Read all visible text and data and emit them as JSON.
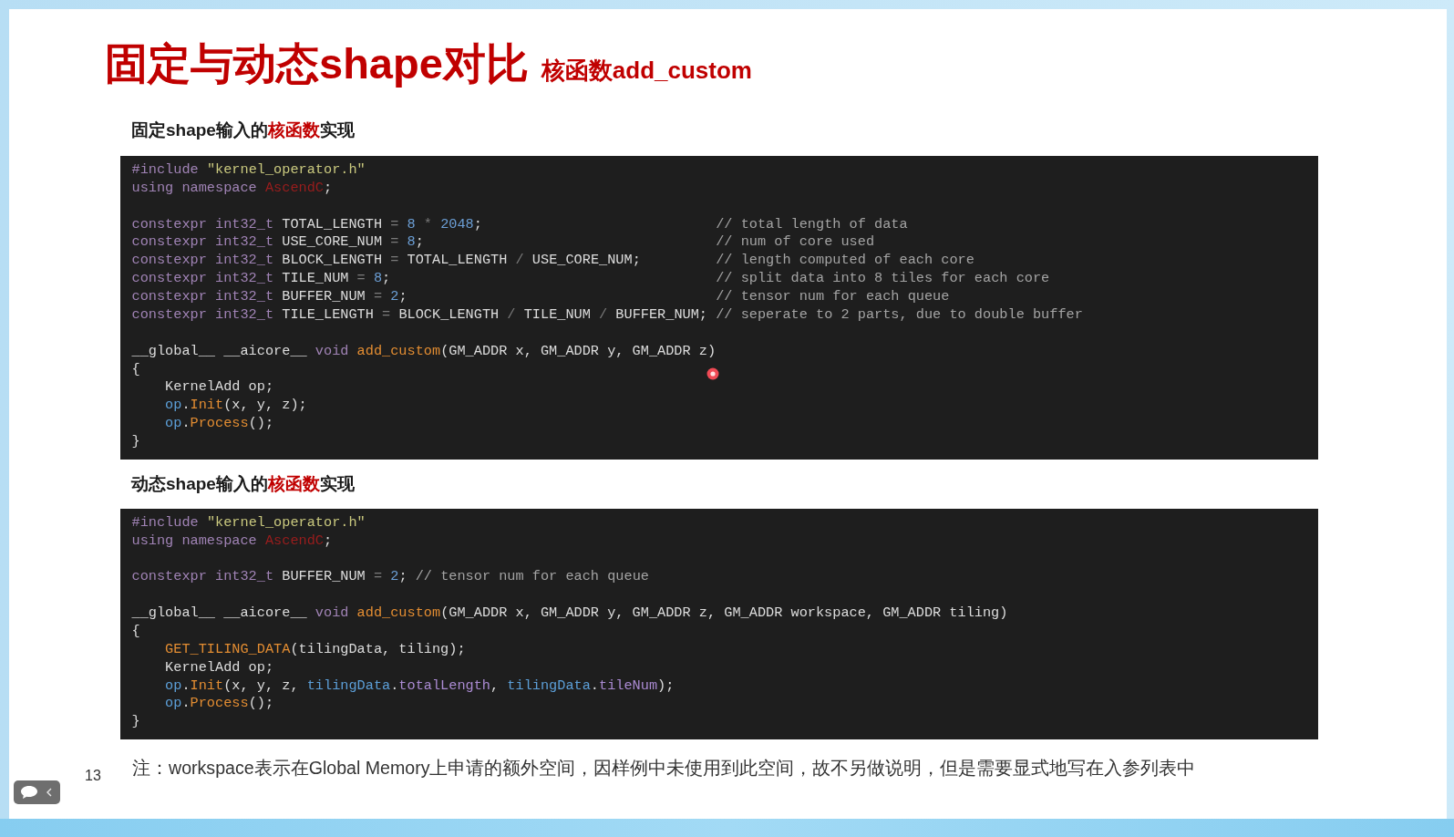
{
  "title": {
    "main": "固定与动态shape对比",
    "sub": "核函数add_custom"
  },
  "sections": [
    {
      "heading": [
        {
          "kind": "plain",
          "text": "固定shape输入的"
        },
        {
          "kind": "highlight",
          "text": "核函数"
        },
        {
          "kind": "plain",
          "text": "实现"
        }
      ],
      "code": {
        "groups": [
          [
            {
              "tokens": [
                {
                  "kind": "kw",
                  "text": "#include "
                },
                {
                  "kind": "str",
                  "text": "\"kernel_operator.h\""
                }
              ]
            },
            {
              "tokens": [
                {
                  "kind": "kw",
                  "text": "using namespace "
                },
                {
                  "kind": "ns",
                  "text": "AscendC"
                },
                {
                  "kind": "plain",
                  "text": ";"
                }
              ]
            }
          ],
          [
            {
              "tokens": [
                {
                  "kind": "kw",
                  "text": "constexpr int32_t "
                },
                {
                  "kind": "plain",
                  "text": "TOTAL_LENGTH "
                },
                {
                  "kind": "op",
                  "text": "= "
                },
                {
                  "kind": "num",
                  "text": "8 "
                },
                {
                  "kind": "op",
                  "text": "* "
                },
                {
                  "kind": "num",
                  "text": "2048"
                },
                {
                  "kind": "plain",
                  "text": ";"
                }
              ],
              "comment": "// total length of data"
            },
            {
              "tokens": [
                {
                  "kind": "kw",
                  "text": "constexpr int32_t "
                },
                {
                  "kind": "plain",
                  "text": "USE_CORE_NUM "
                },
                {
                  "kind": "op",
                  "text": "= "
                },
                {
                  "kind": "num",
                  "text": "8"
                },
                {
                  "kind": "plain",
                  "text": ";"
                }
              ],
              "comment": "// num of core used"
            },
            {
              "tokens": [
                {
                  "kind": "kw",
                  "text": "constexpr int32_t "
                },
                {
                  "kind": "plain",
                  "text": "BLOCK_LENGTH "
                },
                {
                  "kind": "op",
                  "text": "= "
                },
                {
                  "kind": "plain",
                  "text": "TOTAL_LENGTH "
                },
                {
                  "kind": "op",
                  "text": "/ "
                },
                {
                  "kind": "plain",
                  "text": "USE_CORE_NUM;"
                }
              ],
              "comment": "// length computed of each core"
            },
            {
              "tokens": [
                {
                  "kind": "kw",
                  "text": "constexpr int32_t "
                },
                {
                  "kind": "plain",
                  "text": "TILE_NUM "
                },
                {
                  "kind": "op",
                  "text": "= "
                },
                {
                  "kind": "num",
                  "text": "8"
                },
                {
                  "kind": "plain",
                  "text": ";"
                }
              ],
              "comment": "// split data into 8 tiles for each core"
            },
            {
              "tokens": [
                {
                  "kind": "kw",
                  "text": "constexpr int32_t "
                },
                {
                  "kind": "plain",
                  "text": "BUFFER_NUM "
                },
                {
                  "kind": "op",
                  "text": "= "
                },
                {
                  "kind": "num",
                  "text": "2"
                },
                {
                  "kind": "plain",
                  "text": ";"
                }
              ],
              "comment": "// tensor num for each queue"
            },
            {
              "tokens": [
                {
                  "kind": "kw",
                  "text": "constexpr int32_t "
                },
                {
                  "kind": "plain",
                  "text": "TILE_LENGTH "
                },
                {
                  "kind": "op",
                  "text": "= "
                },
                {
                  "kind": "plain",
                  "text": "BLOCK_LENGTH "
                },
                {
                  "kind": "op",
                  "text": "/ "
                },
                {
                  "kind": "plain",
                  "text": "TILE_NUM "
                },
                {
                  "kind": "op",
                  "text": "/ "
                },
                {
                  "kind": "plain",
                  "text": "BUFFER_NUM;"
                }
              ],
              "comment": "// seperate to 2 parts, due to double buffer"
            }
          ],
          [
            {
              "tokens": [
                {
                  "kind": "plain",
                  "text": "__global__ __aicore__ "
                },
                {
                  "kind": "kw",
                  "text": "void "
                },
                {
                  "kind": "fn",
                  "text": "add_custom"
                },
                {
                  "kind": "plain",
                  "text": "(GM_ADDR x, GM_ADDR y, GM_ADDR z)"
                }
              ]
            },
            {
              "tokens": [
                {
                  "kind": "plain",
                  "text": "{"
                }
              ],
              "children": [
                {
                  "tokens": [
                    {
                      "kind": "plain",
                      "text": "KernelAdd op;"
                    }
                  ]
                },
                {
                  "tokens": [
                    {
                      "kind": "obj",
                      "text": "op"
                    },
                    {
                      "kind": "plain",
                      "text": "."
                    },
                    {
                      "kind": "fn",
                      "text": "Init"
                    },
                    {
                      "kind": "plain",
                      "text": "(x, y, z);"
                    }
                  ]
                },
                {
                  "tokens": [
                    {
                      "kind": "obj",
                      "text": "op"
                    },
                    {
                      "kind": "plain",
                      "text": "."
                    },
                    {
                      "kind": "fn",
                      "text": "Process"
                    },
                    {
                      "kind": "plain",
                      "text": "();"
                    }
                  ]
                }
              ]
            },
            {
              "tokens": [
                {
                  "kind": "plain",
                  "text": "}"
                }
              ]
            }
          ]
        ]
      }
    },
    {
      "heading": [
        {
          "kind": "plain",
          "text": "动态shape输入的"
        },
        {
          "kind": "highlight",
          "text": "核函数"
        },
        {
          "kind": "plain",
          "text": "实现"
        }
      ],
      "code": {
        "groups": [
          [
            {
              "tokens": [
                {
                  "kind": "kw",
                  "text": "#include "
                },
                {
                  "kind": "str",
                  "text": "\"kernel_operator.h\""
                }
              ]
            },
            {
              "tokens": [
                {
                  "kind": "kw",
                  "text": "using namespace "
                },
                {
                  "kind": "ns",
                  "text": "AscendC"
                },
                {
                  "kind": "plain",
                  "text": ";"
                }
              ]
            }
          ],
          [
            {
              "tokens": [
                {
                  "kind": "kw",
                  "text": "constexpr int32_t "
                },
                {
                  "kind": "plain",
                  "text": "BUFFER_NUM "
                },
                {
                  "kind": "op",
                  "text": "= "
                },
                {
                  "kind": "num",
                  "text": "2"
                },
                {
                  "kind": "plain",
                  "text": "; "
                },
                {
                  "kind": "comment",
                  "text": "// tensor num for each queue"
                }
              ]
            }
          ],
          [
            {
              "tokens": [
                {
                  "kind": "plain",
                  "text": "__global__ __aicore__ "
                },
                {
                  "kind": "kw",
                  "text": "void "
                },
                {
                  "kind": "fn",
                  "text": "add_custom"
                },
                {
                  "kind": "plain",
                  "text": "(GM_ADDR x, GM_ADDR y, GM_ADDR z, GM_ADDR workspace, GM_ADDR tiling)"
                }
              ]
            },
            {
              "tokens": [
                {
                  "kind": "plain",
                  "text": "{"
                }
              ],
              "children": [
                {
                  "tokens": [
                    {
                      "kind": "fn",
                      "text": "GET_TILING_DATA"
                    },
                    {
                      "kind": "plain",
                      "text": "(tilingData, tiling);"
                    }
                  ]
                },
                {
                  "tokens": [
                    {
                      "kind": "plain",
                      "text": "KernelAdd op;"
                    }
                  ]
                },
                {
                  "tokens": [
                    {
                      "kind": "obj",
                      "text": "op"
                    },
                    {
                      "kind": "plain",
                      "text": "."
                    },
                    {
                      "kind": "fn",
                      "text": "Init"
                    },
                    {
                      "kind": "plain",
                      "text": "(x, y, z, "
                    },
                    {
                      "kind": "obj",
                      "text": "tilingData"
                    },
                    {
                      "kind": "plain",
                      "text": "."
                    },
                    {
                      "kind": "member",
                      "text": "totalLength"
                    },
                    {
                      "kind": "plain",
                      "text": ", "
                    },
                    {
                      "kind": "obj",
                      "text": "tilingData"
                    },
                    {
                      "kind": "plain",
                      "text": "."
                    },
                    {
                      "kind": "member",
                      "text": "tileNum"
                    },
                    {
                      "kind": "plain",
                      "text": ");"
                    }
                  ]
                },
                {
                  "tokens": [
                    {
                      "kind": "obj",
                      "text": "op"
                    },
                    {
                      "kind": "plain",
                      "text": "."
                    },
                    {
                      "kind": "fn",
                      "text": "Process"
                    },
                    {
                      "kind": "plain",
                      "text": "();"
                    }
                  ]
                }
              ]
            },
            {
              "tokens": [
                {
                  "kind": "plain",
                  "text": "}"
                }
              ]
            }
          ]
        ]
      }
    }
  ],
  "footer": {
    "page_number": "13",
    "note": "注：workspace表示在Global Memory上申请的额外空间，因样例中未使用到此空间，故不另做说明，但是需要显式地写在入参列表中"
  }
}
